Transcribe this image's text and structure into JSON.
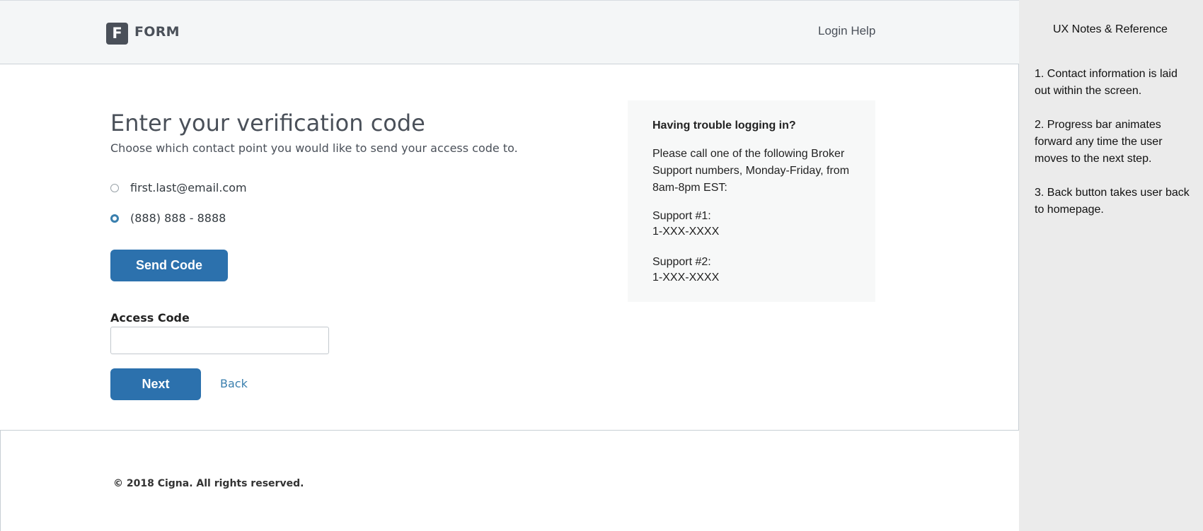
{
  "header": {
    "logo_letter": "F",
    "logo_text": "FORM",
    "login_help": "Login Help"
  },
  "main": {
    "title": "Enter your verification code",
    "subtitle": "Choose which contact point you would like to send your access code to.",
    "options": [
      {
        "label": "first.last@email.com",
        "selected": false
      },
      {
        "label": "(888) 888 - 8888",
        "selected": true
      }
    ],
    "send_code_label": "Send Code",
    "access_code_label": "Access Code",
    "access_code_value": "",
    "next_label": "Next",
    "back_label": "Back"
  },
  "help": {
    "title": "Having trouble logging in?",
    "body": "Please call one of the following Broker Support numbers, Monday-Friday, from 8am-8pm EST:",
    "support1_label": "Support #1:",
    "support1_number": "1-XXX-XXXX",
    "support2_label": "Support #2:",
    "support2_number": "1-XXX-XXXX"
  },
  "footer": {
    "copyright": "© 2018 Cigna. All rights reserved."
  },
  "notes": {
    "title": "UX Notes & Reference",
    "items": [
      "1. Contact information is laid out within the screen.",
      "2. Progress bar animates forward any time the user moves to the next step.",
      "3. Back button takes user back to homepage."
    ]
  },
  "colors": {
    "primary": "#2c71ad",
    "link": "#3a7fae",
    "header_bg": "#f4f6f7",
    "notes_bg": "#ebebeb"
  }
}
